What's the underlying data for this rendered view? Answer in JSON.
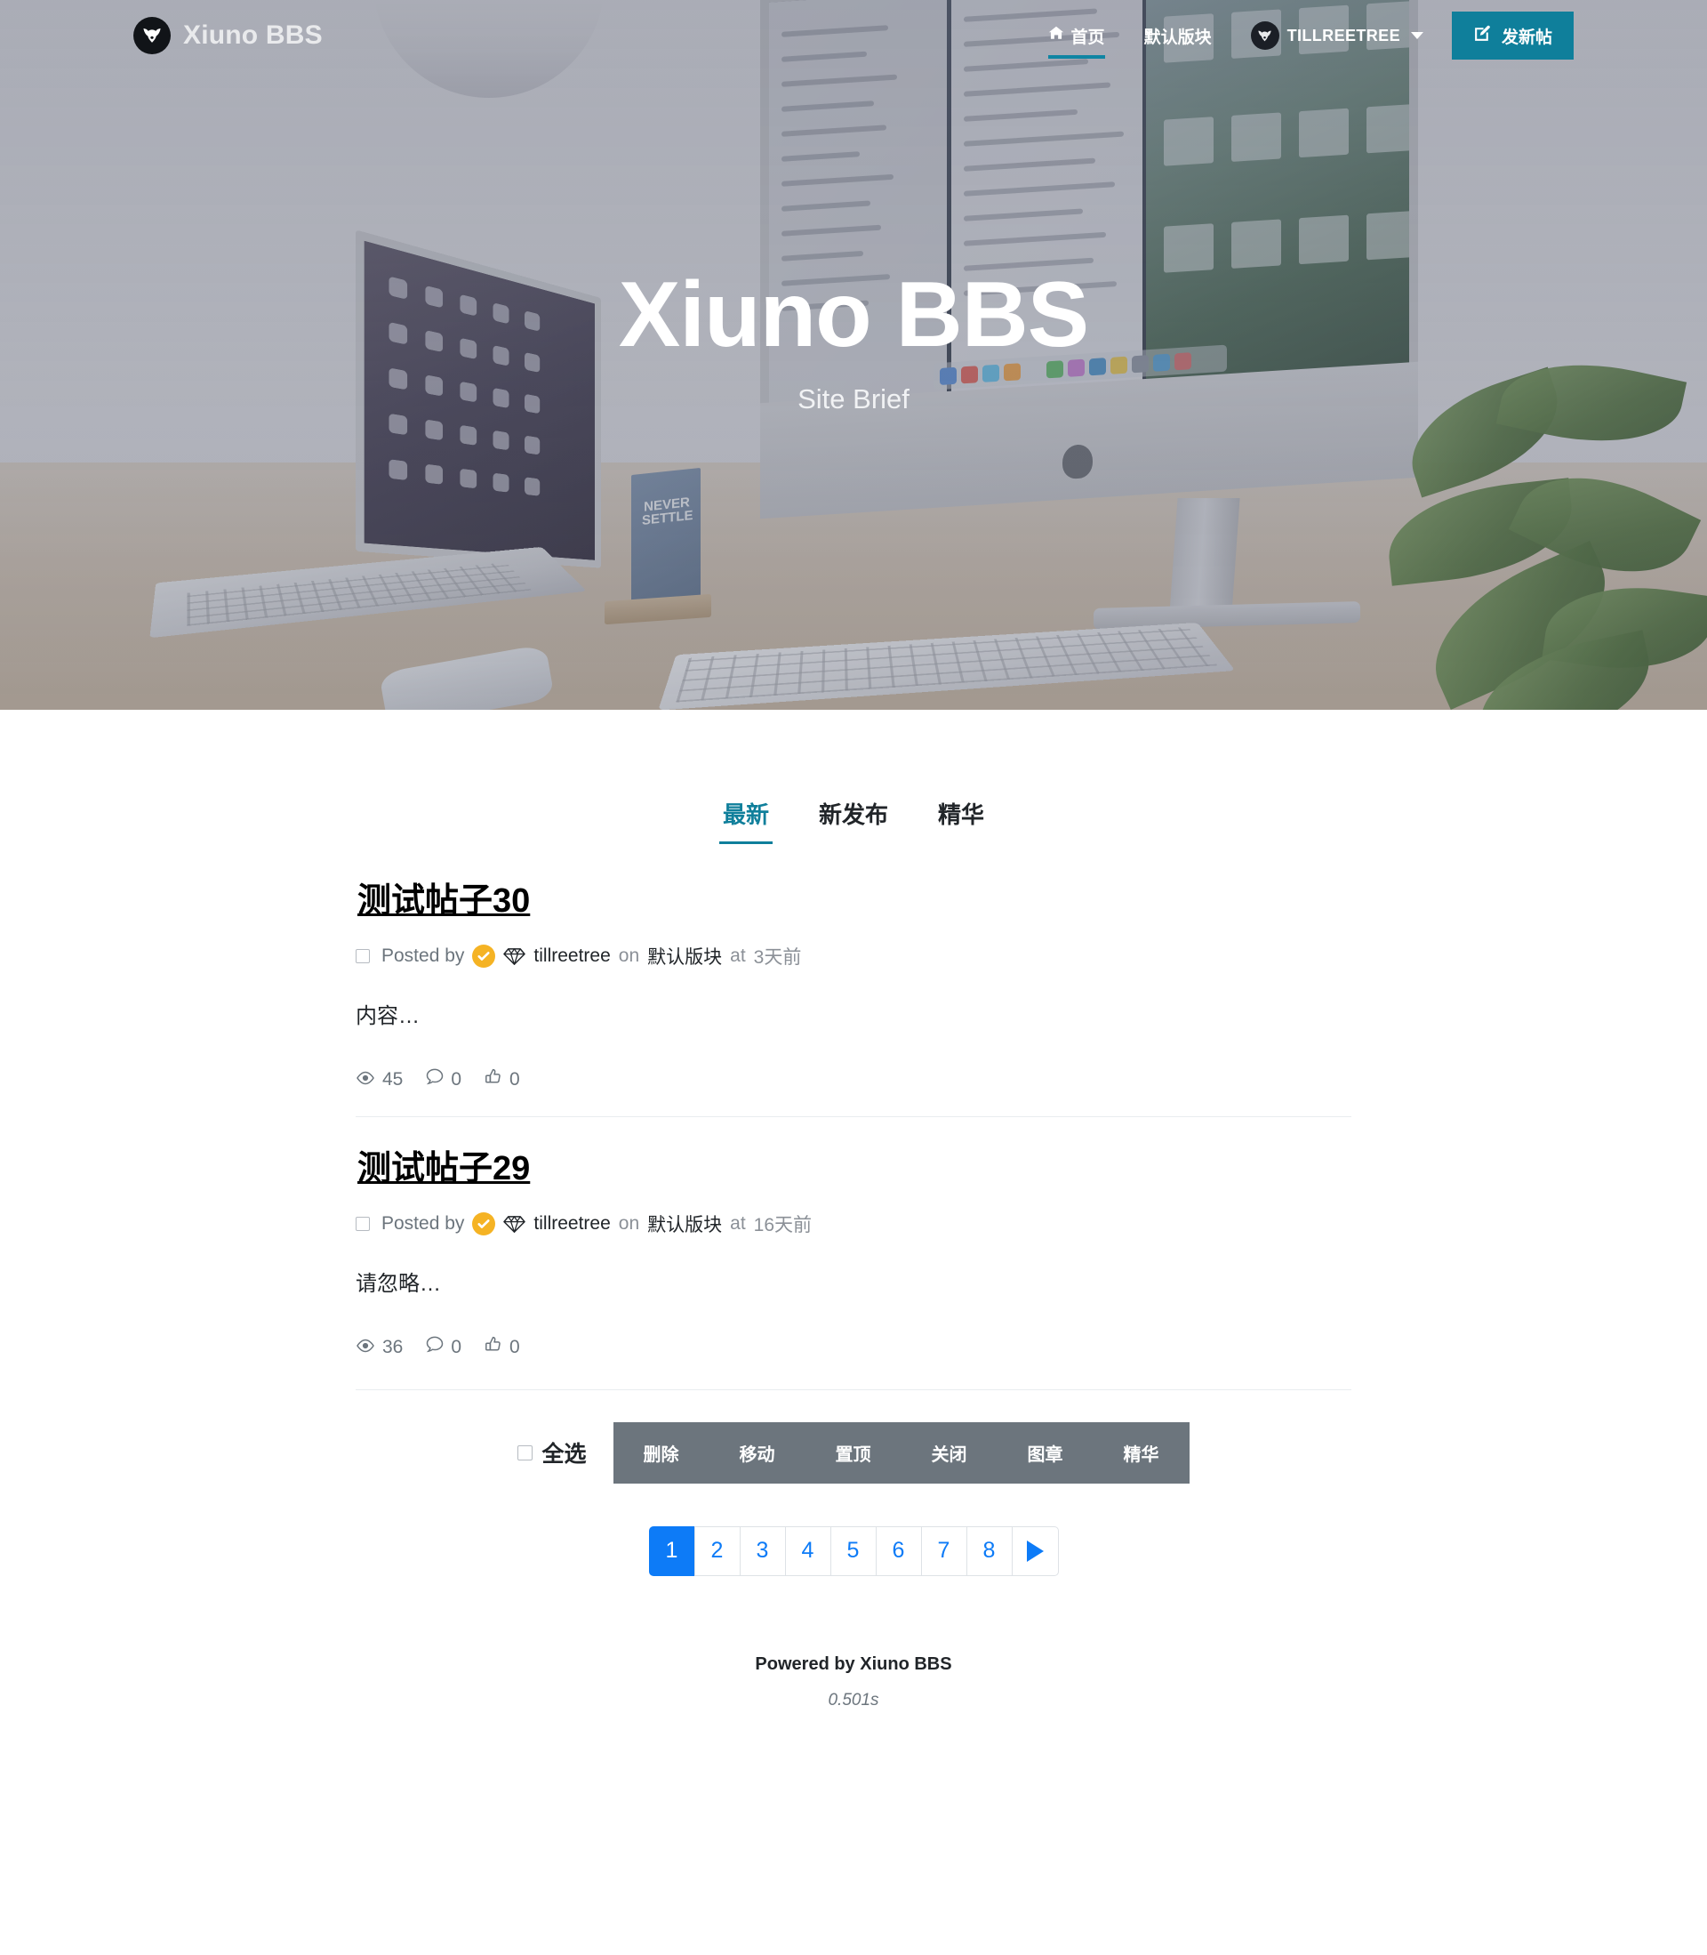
{
  "site": {
    "brand": "Xiuno BBS",
    "hero_title": "Xiuno BBS",
    "hero_subtitle": "Site Brief",
    "accent_teal": "#0f7f9b",
    "accent_blue": "#0d7bf7",
    "action_gray": "#6c757d",
    "badge_yellow": "#f5b324"
  },
  "nav": {
    "home": "首页",
    "forum": "默认版块",
    "username": "TILLREETREE",
    "new_post": "发新帖"
  },
  "tabs": [
    {
      "label": "最新",
      "active": true
    },
    {
      "label": "新发布",
      "active": false
    },
    {
      "label": "精华",
      "active": false
    }
  ],
  "posts": [
    {
      "title": "测试帖子30",
      "posted_by": "Posted by",
      "author": "tillreetree",
      "on": "on",
      "forum": "默认版块",
      "at": "at",
      "time": "3天前",
      "excerpt": "内容…",
      "views": "45",
      "comments": "0",
      "likes": "0"
    },
    {
      "title": "测试帖子29",
      "posted_by": "Posted by",
      "author": "tillreetree",
      "on": "on",
      "forum": "默认版块",
      "at": "at",
      "time": "16天前",
      "excerpt": "请忽略…",
      "views": "36",
      "comments": "0",
      "likes": "0"
    }
  ],
  "actionbar": {
    "select_all": "全选",
    "buttons": [
      "删除",
      "移动",
      "置顶",
      "关闭",
      "图章",
      "精华"
    ]
  },
  "pagination": {
    "pages": [
      "1",
      "2",
      "3",
      "4",
      "5",
      "6",
      "7",
      "8"
    ],
    "active": "1"
  },
  "footer": {
    "powered": "Powered by Xiuno BBS",
    "render_time": "0.501s"
  }
}
